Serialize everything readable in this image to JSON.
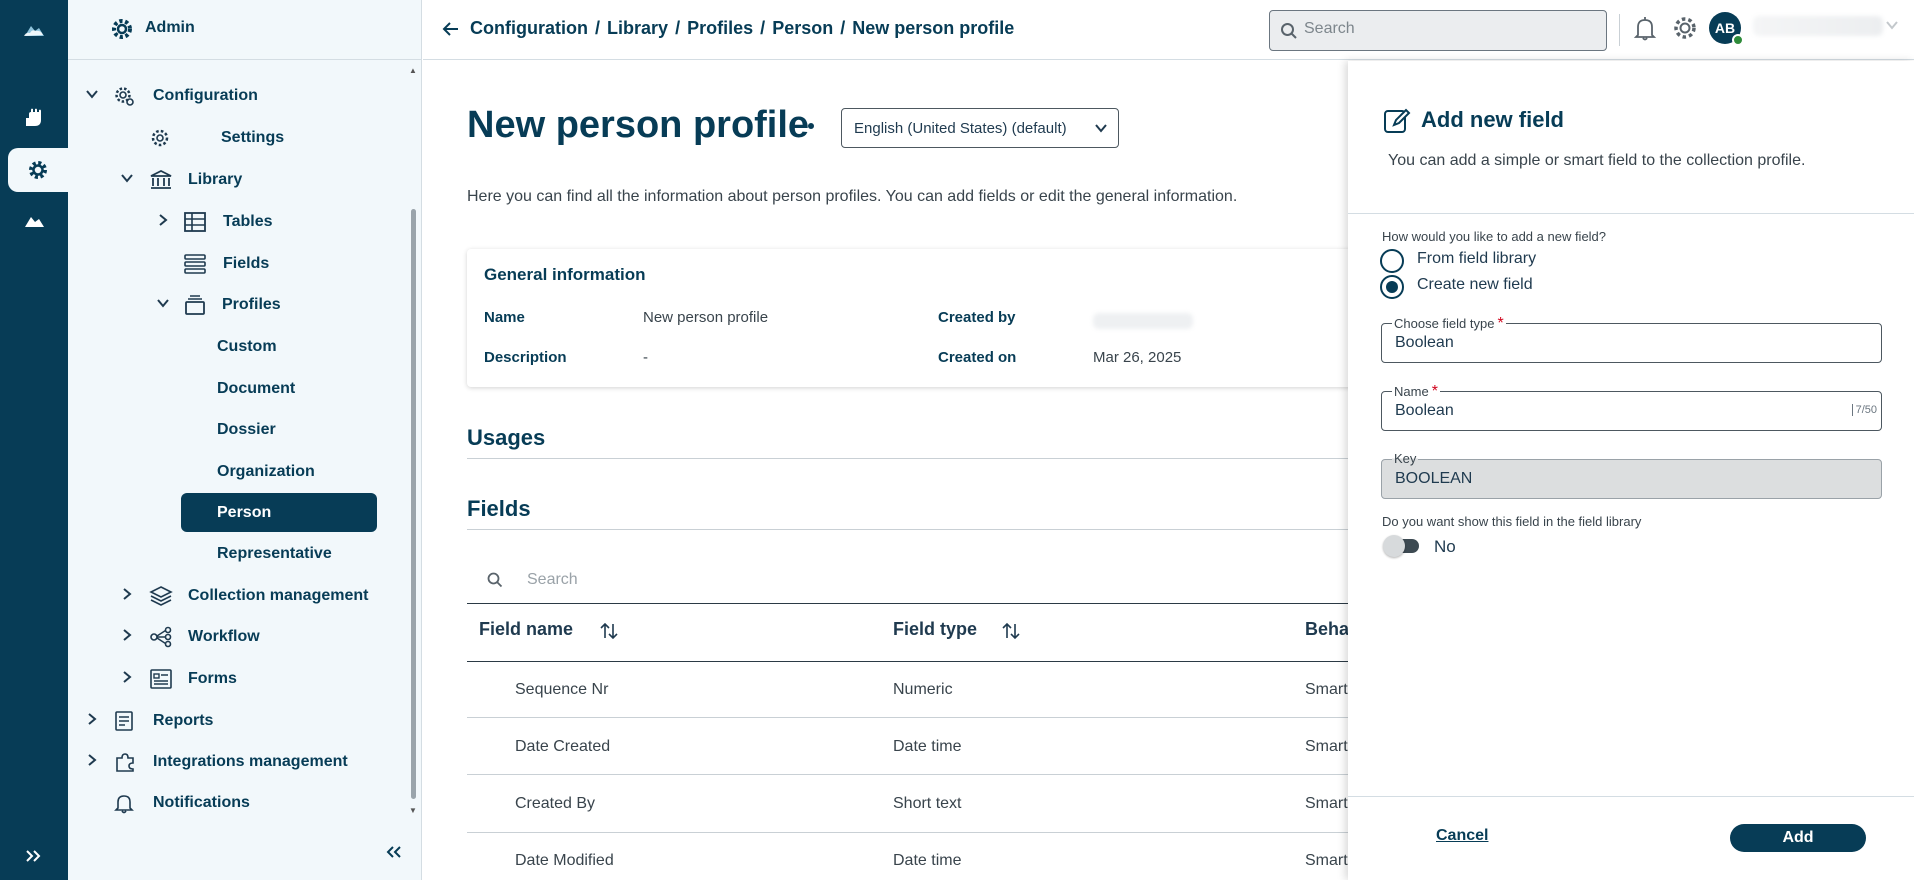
{
  "rail": {
    "items": [
      "cloud-icon",
      "hand-icon",
      "settings-cog-icon",
      "cloud-alt-icon"
    ],
    "expand_icon": "double-chevron-right-icon"
  },
  "sidebar": {
    "header": "Admin",
    "items": [
      {
        "label": "Configuration"
      },
      {
        "label": "Settings"
      },
      {
        "label": "Library"
      },
      {
        "label": "Tables"
      },
      {
        "label": "Fields"
      },
      {
        "label": "Profiles"
      },
      {
        "label": "Custom"
      },
      {
        "label": "Document"
      },
      {
        "label": "Dossier"
      },
      {
        "label": "Organization"
      },
      {
        "label": "Person"
      },
      {
        "label": "Representative"
      },
      {
        "label": "Collection management"
      },
      {
        "label": "Workflow"
      },
      {
        "label": "Forms"
      },
      {
        "label": "Reports"
      },
      {
        "label": "Integrations management"
      },
      {
        "label": "Notifications"
      }
    ],
    "selected": "Person"
  },
  "topbar": {
    "breadcrumb": [
      "Configuration",
      "Library",
      "Profiles",
      "Person",
      "New person profile"
    ],
    "separator": "/",
    "search_placeholder": "Search",
    "avatar_initials": "AB"
  },
  "main": {
    "title": "New person profile",
    "language": "English (United States) (default)",
    "intro": "Here you can find all the information about person profiles. You can add fields or edit the general information.",
    "general": {
      "title": "General information",
      "name_label": "Name",
      "name_value": "New person profile",
      "description_label": "Description",
      "description_value": "-",
      "created_by_label": "Created by",
      "created_on_label": "Created on",
      "created_on_value": "Mar 26, 2025"
    },
    "usages_title": "Usages",
    "fields_title": "Fields",
    "fields_search_placeholder": "Search",
    "columns": [
      "Field name",
      "Field type",
      "Beha"
    ],
    "rows": [
      {
        "name": "Sequence Nr",
        "type": "Numeric",
        "behavior": "Smart"
      },
      {
        "name": "Date Created",
        "type": "Date time",
        "behavior": "Smart"
      },
      {
        "name": "Created By",
        "type": "Short text",
        "behavior": "Smart"
      },
      {
        "name": "Date Modified",
        "type": "Date time",
        "behavior": "Smart"
      }
    ]
  },
  "drawer": {
    "title": "Add new field",
    "subtitle": "You can add a simple or smart field to the collection profile.",
    "question": "How would you like to add a new field?",
    "option_library": "From field library",
    "option_create": "Create new field",
    "selected_option": "Create new field",
    "field_type_label": "Choose field type",
    "field_type_value": "Boolean",
    "name_label": "Name",
    "name_value": "Boolean",
    "name_counter": "7/50",
    "key_label": "Key",
    "key_value": "BOOLEAN",
    "show_question": "Do you want show this field in the field library",
    "show_value": "No",
    "cancel_label": "Cancel",
    "add_label": "Add",
    "required_mark": "*"
  },
  "colors": {
    "primary": "#073c56",
    "sidebar_bg": "#f2f8fb",
    "required": "#d0021b",
    "online": "#2e8b3a"
  }
}
